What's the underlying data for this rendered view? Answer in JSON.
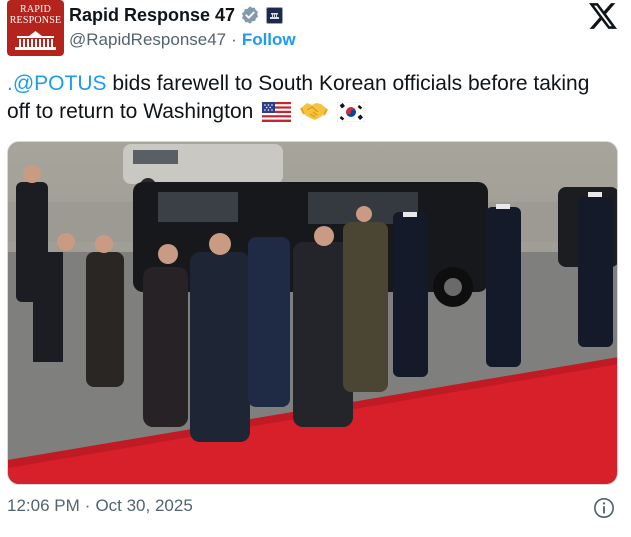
{
  "account": {
    "display_name": "Rapid Response 47",
    "handle": "@RapidResponse47",
    "separator": "·",
    "follow_label": "Follow",
    "avatar_line1": "RAPID",
    "avatar_line2": "RESPONSE"
  },
  "tweet": {
    "mention": ".@POTUS",
    "text": " bids farewell to South Korean officials before taking off to return to Washington",
    "emojis": [
      "flag-us-icon",
      "handshake-icon",
      "flag-kr-icon"
    ]
  },
  "footer": {
    "time": "12:06 PM",
    "separator": "·",
    "date": "Oct 30, 2025"
  },
  "colors": {
    "link": "#1d9bf0",
    "text": "#0f1419",
    "muted": "#536471",
    "carpet": "#d8202b",
    "avatar_bg": "#b5241c"
  }
}
